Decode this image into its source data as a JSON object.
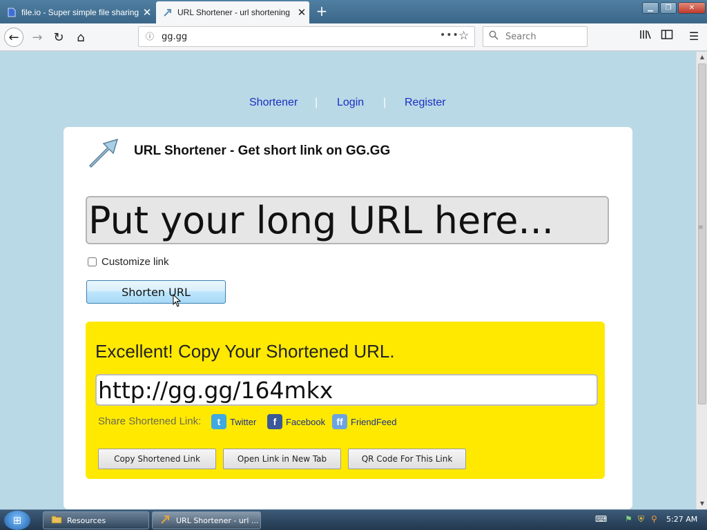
{
  "browser": {
    "tabs": [
      {
        "label": "file.io - Super simple file sharing",
        "favicon": "file-io-icon"
      },
      {
        "label": "URL Shortener - url shortening",
        "favicon": "arrow-icon"
      }
    ],
    "url": "gg.gg",
    "search_placeholder": "Search"
  },
  "site_nav": {
    "shortener": "Shortener",
    "login": "Login",
    "register": "Register",
    "separator": "|"
  },
  "page": {
    "heading": "URL Shortener - Get short link on GG.GG",
    "long_url_placeholder": "Put your long URL here...",
    "customize_label": "Customize link",
    "shorten_button": "Shorten URL"
  },
  "result": {
    "message": "Excellent! Copy Your Shortened URL.",
    "short_url": "http://gg.gg/164mkx",
    "share_label": "Share Shortened Link:",
    "share_links": [
      {
        "label": "Twitter",
        "icon": "twitter-icon",
        "color": "#3fa9e0"
      },
      {
        "label": "Facebook",
        "icon": "facebook-icon",
        "color": "#3b5998"
      },
      {
        "label": "FriendFeed",
        "icon": "friendfeed-icon",
        "color": "#6da4e0"
      }
    ],
    "buttons": {
      "copy": "Copy Shortened Link",
      "open": "Open Link in New Tab",
      "qr": "QR Code For This Link"
    }
  },
  "taskbar": {
    "tasks": [
      "Resources",
      "URL Shortener - url ..."
    ],
    "clock": "5:27 AM"
  },
  "colors": {
    "page_bg": "#b9d9e6",
    "result_bg": "#ffe900",
    "link": "#1a2fc2"
  }
}
